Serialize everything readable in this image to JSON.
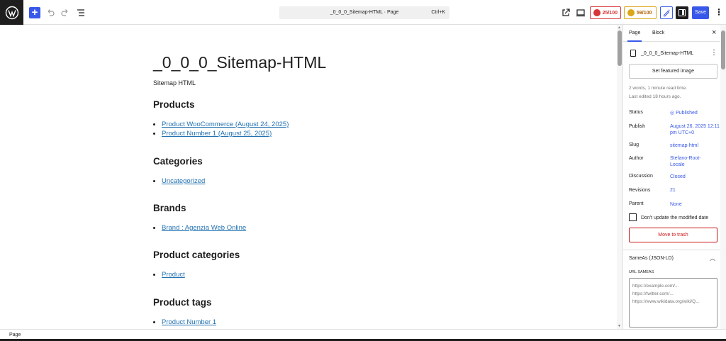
{
  "topbar": {
    "command_title": "_0_0_0_Sitemap-HTML · Page",
    "command_shortcut": "Ctrl+K",
    "seo_score": "25/100",
    "readability_score": "59/100",
    "save_label": "Save",
    "more_label": "⋮",
    "add_label": "+"
  },
  "document": {
    "title": "_0_0_0_Sitemap-HTML",
    "subtitle": "Sitemap HTML",
    "sections": [
      {
        "heading": "Products",
        "links": [
          "Product WooCommerce (August 24, 2025)",
          "Product Number 1 (August 25, 2025)"
        ]
      },
      {
        "heading": "Categories",
        "links": [
          "Uncategorized"
        ]
      },
      {
        "heading": "Brands",
        "links": [
          "Brand : Agenzia Web Online"
        ]
      },
      {
        "heading": "Product categories",
        "links": [
          "Product"
        ]
      },
      {
        "heading": "Product tags",
        "links": [
          "Product Number 1"
        ]
      }
    ]
  },
  "sidebar": {
    "tabs": [
      "Page",
      "Block"
    ],
    "close_label": "×",
    "doc_title": "_0_0_0_Sitemap-HTML",
    "featured_label": "Set featured image",
    "read_time": "2 words, 1 minute read time.",
    "last_edited": "Last edited 18 hours ago.",
    "rows": [
      {
        "label": "Status",
        "value": "Published"
      },
      {
        "label": "Publish",
        "value": "August 26, 2025 12:11 pm UTC+0"
      },
      {
        "label": "Slug",
        "value": "sitemap-html"
      },
      {
        "label": "Author",
        "value": "Stefano-Root-Locale"
      },
      {
        "label": "Discussion",
        "value": "Closed"
      },
      {
        "label": "Revisions",
        "value": "21"
      },
      {
        "label": "Parent",
        "value": "None"
      }
    ],
    "checkbox_label": "Don't update the modified date",
    "trash_label": "Move to trash",
    "sameas_title": "SameAs (JSON-LD)",
    "url_label": "URL SAMEAS",
    "url_placeholder": [
      "https://example.com/...",
      "https://twitter.com/...",
      "https://www.wikidata.org/wiki/Q..."
    ]
  },
  "statusbar": {
    "text": "Page"
  },
  "colors": {
    "accent": "#3858e9",
    "link": "#2271b1",
    "danger": "#cc1818",
    "warning": "#dba617"
  }
}
